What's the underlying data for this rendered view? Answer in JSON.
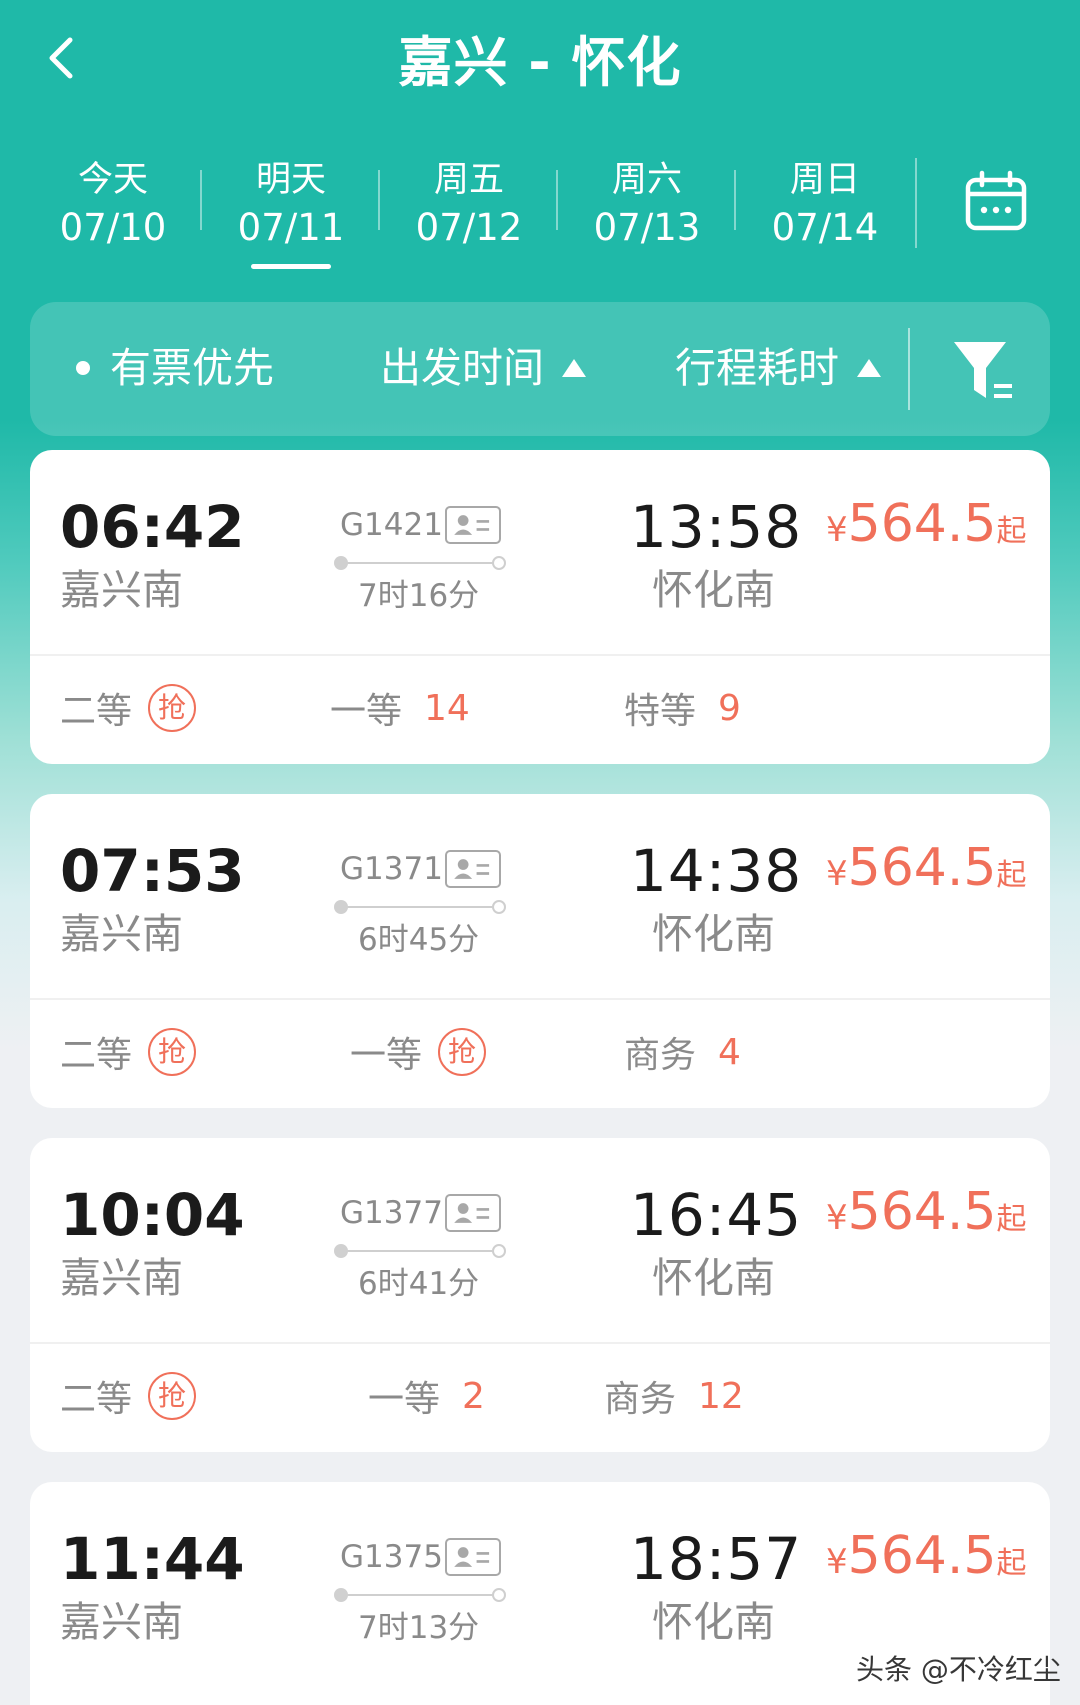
{
  "header": {
    "title": "嘉兴 - 怀化"
  },
  "date_tabs": [
    {
      "dow": "今天",
      "md": "07/10",
      "selected": false
    },
    {
      "dow": "明天",
      "md": "07/11",
      "selected": true
    },
    {
      "dow": "周五",
      "md": "07/12",
      "selected": false
    },
    {
      "dow": "周六",
      "md": "07/13",
      "selected": false
    },
    {
      "dow": "周日",
      "md": "07/14",
      "selected": false
    }
  ],
  "filters": {
    "tickets_first": "有票优先",
    "departure_time": "出发时间",
    "travel_duration": "行程耗时"
  },
  "trains": [
    {
      "dep_time": "06:42",
      "dep_station": "嘉兴南",
      "train_no": "G1421",
      "duration": "7时16分",
      "arr_time": "13:58",
      "arr_station": "怀化南",
      "price_symbol": "¥",
      "price": "564.5",
      "price_suffix": "起",
      "seats": [
        {
          "label": "二等",
          "badge": "抢",
          "count": ""
        },
        {
          "label": "一等",
          "badge": "",
          "count": "14"
        },
        {
          "label": "特等",
          "badge": "",
          "count": "9"
        }
      ]
    },
    {
      "dep_time": "07:53",
      "dep_station": "嘉兴南",
      "train_no": "G1371",
      "duration": "6时45分",
      "arr_time": "14:38",
      "arr_station": "怀化南",
      "price_symbol": "¥",
      "price": "564.5",
      "price_suffix": "起",
      "seats": [
        {
          "label": "二等",
          "badge": "抢",
          "count": ""
        },
        {
          "label": "一等",
          "badge": "抢",
          "count": ""
        },
        {
          "label": "商务",
          "badge": "",
          "count": "4"
        }
      ]
    },
    {
      "dep_time": "10:04",
      "dep_station": "嘉兴南",
      "train_no": "G1377",
      "duration": "6时41分",
      "arr_time": "16:45",
      "arr_station": "怀化南",
      "price_symbol": "¥",
      "price": "564.5",
      "price_suffix": "起",
      "seats": [
        {
          "label": "二等",
          "badge": "抢",
          "count": ""
        },
        {
          "label": "一等",
          "badge": "",
          "count": "2"
        },
        {
          "label": "商务",
          "badge": "",
          "count": "12"
        }
      ]
    },
    {
      "dep_time": "11:44",
      "dep_station": "嘉兴南",
      "train_no": "G1375",
      "duration": "7时13分",
      "arr_time": "18:57",
      "arr_station": "怀化南",
      "price_symbol": "¥",
      "price": "564.5",
      "price_suffix": "起",
      "seats": []
    }
  ],
  "watermark": "头条 @不冷红尘",
  "colors": {
    "header_teal": "#1fb9a8",
    "price_orange": "#f0705a",
    "text_dark": "#1b1b1b",
    "text_gray": "#8a8a8a"
  },
  "icons": [
    "back-arrow-icon",
    "calendar-icon",
    "filter-icon",
    "id-card-icon"
  ]
}
